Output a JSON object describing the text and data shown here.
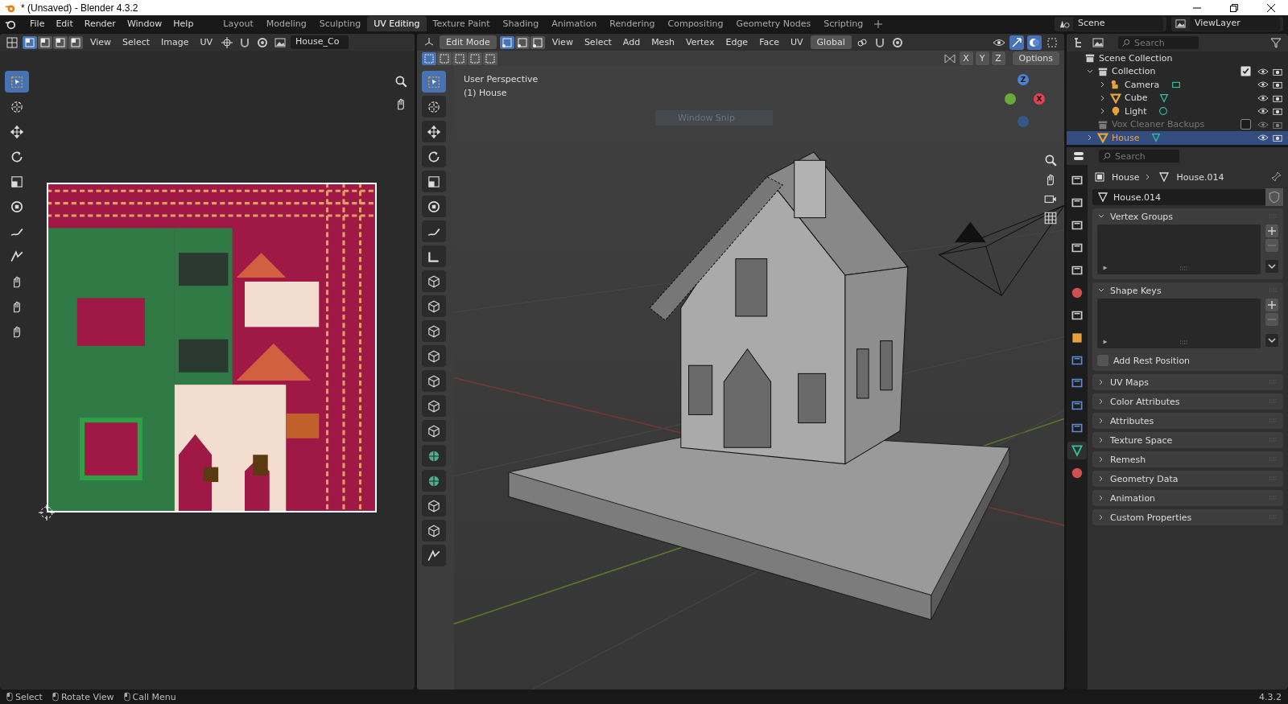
{
  "window": {
    "title": "* (Unsaved) - Blender 4.3.2"
  },
  "menu": [
    "File",
    "Edit",
    "Render",
    "Window",
    "Help"
  ],
  "workspaces": [
    {
      "label": "Layout",
      "selected": false
    },
    {
      "label": "Modeling",
      "selected": false
    },
    {
      "label": "Sculpting",
      "selected": false
    },
    {
      "label": "UV Editing",
      "selected": true
    },
    {
      "label": "Texture Paint",
      "selected": false
    },
    {
      "label": "Shading",
      "selected": false
    },
    {
      "label": "Animation",
      "selected": false
    },
    {
      "label": "Rendering",
      "selected": false
    },
    {
      "label": "Compositing",
      "selected": false
    },
    {
      "label": "Geometry Nodes",
      "selected": false
    },
    {
      "label": "Scripting",
      "selected": false
    }
  ],
  "scene": "Scene",
  "view_layer": "ViewLayer",
  "uv_editor": {
    "menus": [
      "View",
      "Select",
      "Image",
      "UV"
    ],
    "image": "House_Co",
    "select_modes": [
      {
        "selected": true
      },
      {
        "selected": false
      },
      {
        "selected": false
      },
      {
        "selected": false
      }
    ],
    "tools": [
      {
        "kind": "select",
        "selected": true
      },
      {
        "kind": "cursor",
        "selected": false
      },
      {
        "kind": "move",
        "selected": false
      },
      {
        "kind": "rotate",
        "selected": false
      },
      {
        "kind": "scale",
        "selected": false
      },
      {
        "kind": "transform",
        "selected": false
      },
      {
        "kind": "annotate",
        "selected": false
      },
      {
        "kind": "rip",
        "selected": false
      },
      {
        "kind": "grab",
        "selected": false
      },
      {
        "kind": "relax",
        "selected": false
      },
      {
        "kind": "pinch",
        "selected": false
      }
    ]
  },
  "viewport": {
    "mode": "Edit Mode",
    "menus": [
      "View",
      "Select",
      "Add",
      "Mesh",
      "Vertex",
      "Edge",
      "Face",
      "UV"
    ],
    "orientation": "Global",
    "axes": [
      "X",
      "Y",
      "Z"
    ],
    "options": "Options",
    "select_modes": [
      {
        "selected": true
      },
      {
        "selected": false
      },
      {
        "selected": false
      }
    ],
    "overlay": [
      "User Perspective",
      "(1) House"
    ],
    "tooltip": "Window Snip",
    "gizmo": [
      "Z",
      "X"
    ],
    "tools": [
      {
        "kind": "select",
        "selected": true
      },
      {
        "kind": "cursor",
        "selected": false
      },
      {
        "kind": "move",
        "selected": false
      },
      {
        "kind": "rotate",
        "selected": false
      },
      {
        "kind": "scale",
        "selected": false
      },
      {
        "kind": "transform",
        "selected": false
      },
      {
        "kind": "annotate",
        "selected": false
      },
      {
        "kind": "measure",
        "selected": false
      },
      {
        "kind": "add-cube",
        "selected": false
      },
      {
        "kind": "extrude",
        "selected": false
      },
      {
        "kind": "inset",
        "selected": false
      },
      {
        "kind": "bevel",
        "selected": false
      },
      {
        "kind": "loop-cut",
        "selected": false
      },
      {
        "kind": "knife",
        "selected": false
      },
      {
        "kind": "poly-build",
        "selected": false
      },
      {
        "kind": "spin",
        "selected": false
      },
      {
        "kind": "smooth",
        "selected": false
      },
      {
        "kind": "shrink",
        "selected": false
      },
      {
        "kind": "shear",
        "selected": false
      },
      {
        "kind": "rip",
        "selected": false
      }
    ]
  },
  "outliner": {
    "search": {
      "placeholder": "Search"
    },
    "tree": [
      {
        "name": "Scene Collection",
        "kind": "collection",
        "children": [
          {
            "name": "Collection",
            "kind": "collection",
            "expanded": true,
            "checked": true,
            "selected": false,
            "children": [
              {
                "name": "Camera",
                "kind": "camera",
                "expanded": false,
                "selected": false
              },
              {
                "name": "Cube",
                "kind": "mesh",
                "expanded": false,
                "selected": false
              },
              {
                "name": "Light",
                "kind": "light",
                "expanded": false,
                "selected": false
              }
            ]
          },
          {
            "name": "Vox Cleaner Backups",
            "kind": "collection",
            "checked": false,
            "disabled": true,
            "selected": false
          },
          {
            "name": "House",
            "kind": "mesh",
            "expanded": false,
            "selected": true
          }
        ]
      }
    ]
  },
  "properties": {
    "search": {
      "placeholder": "Search"
    },
    "breadcrumb": [
      "House",
      "House.014"
    ],
    "mesh_name": "House.014",
    "tabs": [
      {
        "kind": "tool",
        "selected": false
      },
      {
        "kind": "render",
        "selected": false
      },
      {
        "kind": "output",
        "selected": false
      },
      {
        "kind": "view-layer",
        "selected": false
      },
      {
        "kind": "scene",
        "selected": false
      },
      {
        "kind": "world",
        "selected": false
      },
      {
        "kind": "collection",
        "selected": false
      },
      {
        "kind": "object",
        "selected": false
      },
      {
        "kind": "modifiers",
        "selected": false
      },
      {
        "kind": "particles",
        "selected": false
      },
      {
        "kind": "physics",
        "selected": false
      },
      {
        "kind": "constraints",
        "selected": false
      },
      {
        "kind": "data",
        "selected": true
      },
      {
        "kind": "material",
        "selected": false
      }
    ],
    "panels": [
      {
        "title": "Vertex Groups",
        "expanded": true
      },
      {
        "title": "Shape Keys",
        "expanded": true,
        "checkbox": {
          "label": "Add Rest Position",
          "checked": false
        }
      },
      {
        "title": "UV Maps",
        "expanded": false
      },
      {
        "title": "Color Attributes",
        "expanded": false
      },
      {
        "title": "Attributes",
        "expanded": false
      },
      {
        "title": "Texture Space",
        "expanded": false
      },
      {
        "title": "Remesh",
        "expanded": false
      },
      {
        "title": "Geometry Data",
        "expanded": false
      },
      {
        "title": "Animation",
        "expanded": false
      },
      {
        "title": "Custom Properties",
        "expanded": false
      }
    ]
  },
  "status_bar": {
    "hints": [
      "Select",
      "Rotate View",
      "Call Menu"
    ],
    "version": "4.3.2"
  }
}
